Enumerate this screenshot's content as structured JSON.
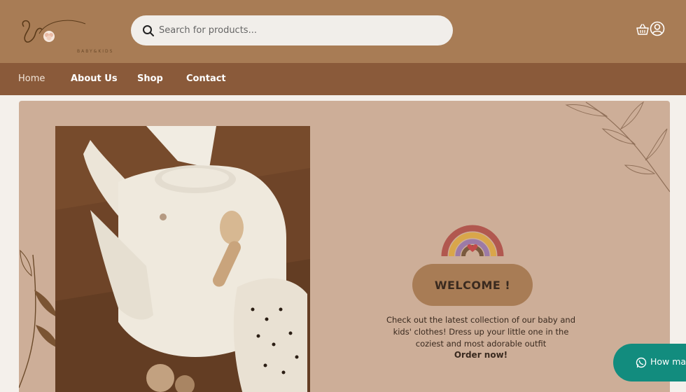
{
  "header": {
    "logo_text": "BABY&KIDS",
    "search": {
      "placeholder": "Search for products..."
    },
    "icons": [
      "search-icon",
      "cart-icon",
      "user-icon"
    ]
  },
  "nav": {
    "items": [
      {
        "label": "Home"
      },
      {
        "label": "About Us"
      },
      {
        "label": "Shop"
      },
      {
        "label": "Contact"
      }
    ]
  },
  "hero": {
    "welcome_label": "WELCOME !",
    "description": "Check out the latest collection of our baby and kids' clothes! Dress up your little one in the coziest and most adorable outfit",
    "cta": "Order now!"
  },
  "whatsapp": {
    "label": "How may"
  },
  "colors": {
    "topbar": "#a87c55",
    "navbar": "#8a5a3a",
    "hero_bg": "#cdae98",
    "welcome_button": "#a87c55",
    "whatsapp": "#128c7e"
  }
}
